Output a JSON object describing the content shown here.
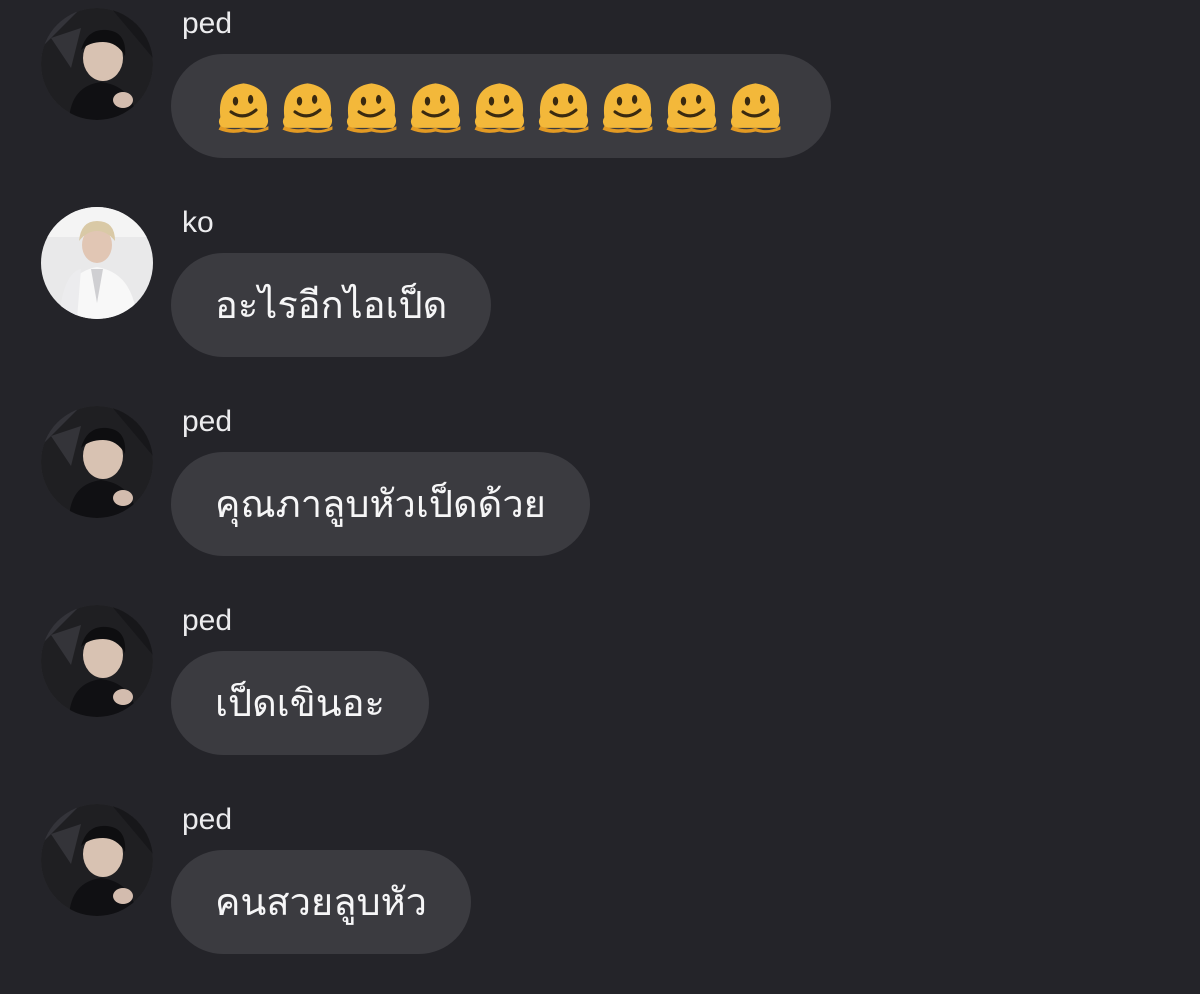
{
  "messages": [
    {
      "sender": "ped",
      "avatar": "ped-avatar",
      "text": "",
      "emoji": [
        "melting-face-emoji",
        "melting-face-emoji",
        "melting-face-emoji",
        "melting-face-emoji",
        "melting-face-emoji",
        "melting-face-emoji",
        "melting-face-emoji",
        "melting-face-emoji",
        "melting-face-emoji"
      ]
    },
    {
      "sender": "ko",
      "avatar": "ko-avatar",
      "text": "อะไรอีกไอเป็ด"
    },
    {
      "sender": "ped",
      "avatar": "ped-avatar",
      "text": "คุณภาลูบหัวเป็ดด้วย"
    },
    {
      "sender": "ped",
      "avatar": "ped-avatar",
      "text": "เป็ดเขินอะ"
    },
    {
      "sender": "ped",
      "avatar": "ped-avatar",
      "text": "คนสวยลูบหัว"
    }
  ],
  "colors": {
    "background": "#242429",
    "bubble": "#3b3b40",
    "sender_text": "#ececee",
    "message_text": "#f6f6f7",
    "emoji_face": "#f3b83a"
  }
}
